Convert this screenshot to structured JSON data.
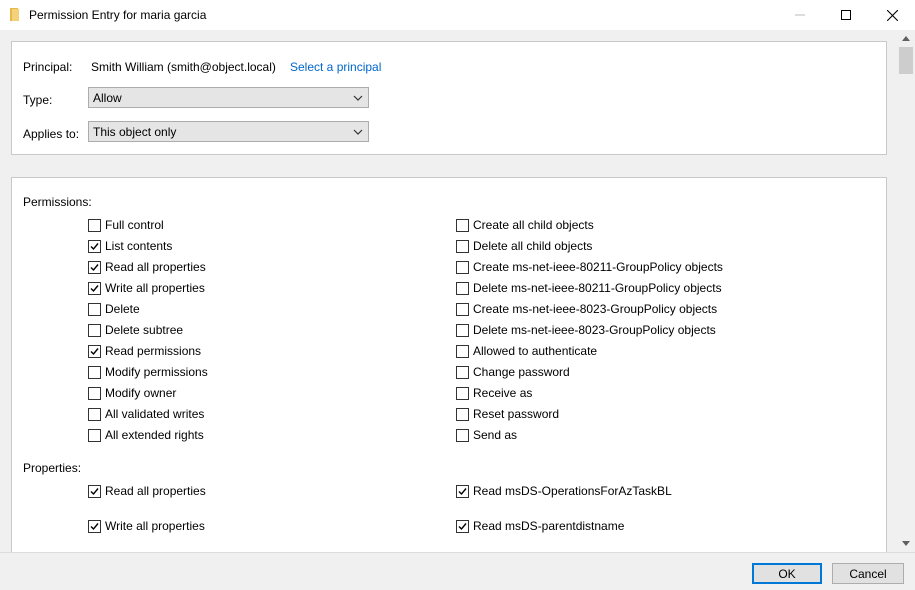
{
  "window": {
    "title": "Permission Entry for maria garcia"
  },
  "principal": {
    "label": "Principal:",
    "value": "Smith William (smith@object.local)",
    "select_link": "Select a principal"
  },
  "type": {
    "label": "Type:",
    "selected": "Allow"
  },
  "applies_to": {
    "label": "Applies to:",
    "selected": "This object only"
  },
  "permissions": {
    "heading": "Permissions:",
    "left": [
      {
        "label": "Full control",
        "checked": false
      },
      {
        "label": "List contents",
        "checked": true
      },
      {
        "label": "Read all properties",
        "checked": true
      },
      {
        "label": "Write all properties",
        "checked": true
      },
      {
        "label": "Delete",
        "checked": false
      },
      {
        "label": "Delete subtree",
        "checked": false
      },
      {
        "label": "Read permissions",
        "checked": true
      },
      {
        "label": "Modify permissions",
        "checked": false
      },
      {
        "label": "Modify owner",
        "checked": false
      },
      {
        "label": "All validated writes",
        "checked": false
      },
      {
        "label": "All extended rights",
        "checked": false
      }
    ],
    "right": [
      {
        "label": "Create all child objects",
        "checked": false
      },
      {
        "label": "Delete all child objects",
        "checked": false
      },
      {
        "label": "Create ms-net-ieee-80211-GroupPolicy objects",
        "checked": false
      },
      {
        "label": "Delete ms-net-ieee-80211-GroupPolicy objects",
        "checked": false
      },
      {
        "label": "Create ms-net-ieee-8023-GroupPolicy objects",
        "checked": false
      },
      {
        "label": "Delete ms-net-ieee-8023-GroupPolicy objects",
        "checked": false
      },
      {
        "label": "Allowed to authenticate",
        "checked": false
      },
      {
        "label": "Change password",
        "checked": false
      },
      {
        "label": "Receive as",
        "checked": false
      },
      {
        "label": "Reset password",
        "checked": false
      },
      {
        "label": "Send as",
        "checked": false
      }
    ]
  },
  "properties": {
    "heading": "Properties:",
    "left": [
      {
        "label": "Read all properties",
        "checked": true
      },
      {
        "label": "Write all properties",
        "checked": true
      }
    ],
    "right": [
      {
        "label": "Read msDS-OperationsForAzTaskBL",
        "checked": true
      },
      {
        "label": "Read msDS-parentdistname",
        "checked": true
      }
    ]
  },
  "footer": {
    "ok_label": "OK",
    "cancel_label": "Cancel"
  },
  "colors": {
    "accent": "#0078d7",
    "link": "#0066cc",
    "background": "#f0f0f0"
  }
}
